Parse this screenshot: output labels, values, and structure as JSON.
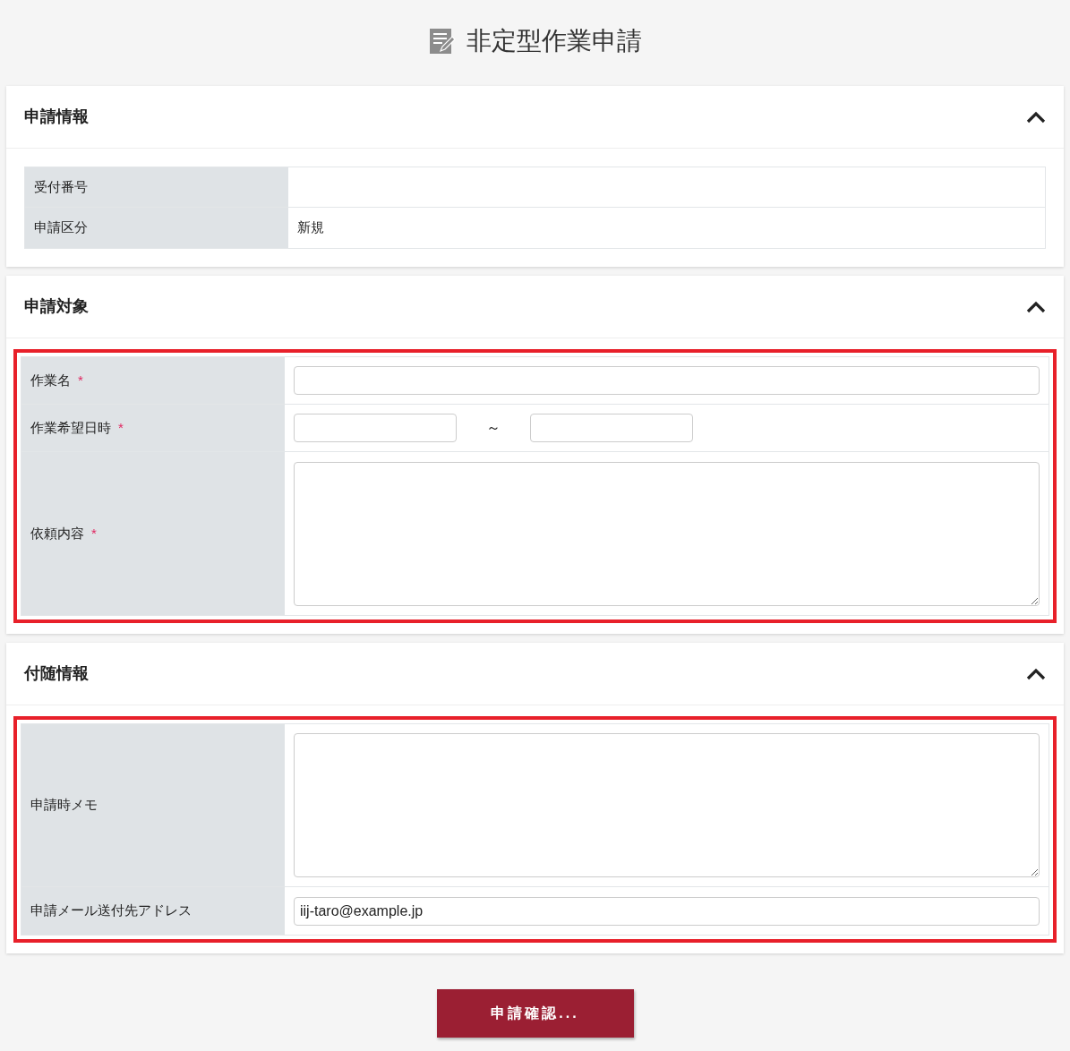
{
  "title": "非定型作業申請",
  "sections": [
    {
      "heading": "申請情報",
      "expanded": true,
      "highlighted": false,
      "rows": [
        {
          "kind": "text",
          "label": "受付番号"
        },
        {
          "kind": "text",
          "label": "申請区分",
          "value": "新規"
        }
      ]
    },
    {
      "heading": "申請対象",
      "expanded": true,
      "highlighted": true,
      "rows": [
        {
          "kind": "input",
          "label": "作業名",
          "mark": "*"
        },
        {
          "kind": "range",
          "label": "作業希望日時",
          "mark": "*",
          "separator": "～"
        },
        {
          "kind": "textarea",
          "label": "依頼内容",
          "mark": "*"
        }
      ]
    },
    {
      "heading": "付随情報",
      "expanded": true,
      "highlighted": true,
      "rows": [
        {
          "kind": "textarea",
          "label": "申請時メモ"
        },
        {
          "kind": "input",
          "label": "申請メール送付先アドレス",
          "value": "iij-taro@example.jp"
        }
      ]
    }
  ],
  "submit": "申請確認..."
}
